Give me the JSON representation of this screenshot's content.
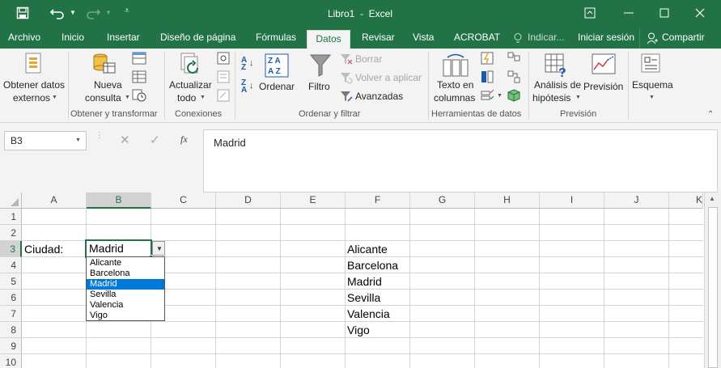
{
  "window": {
    "title": "Libro1  -  Excel"
  },
  "tabs": [
    {
      "label": "Archivo"
    },
    {
      "label": "Inicio"
    },
    {
      "label": "Insertar"
    },
    {
      "label": "Diseño de página"
    },
    {
      "label": "Fórmulas"
    },
    {
      "label": "Datos"
    },
    {
      "label": "Revisar"
    },
    {
      "label": "Vista"
    },
    {
      "label": "ACROBAT"
    },
    {
      "label": "Indicar..."
    }
  ],
  "account": {
    "signin": "Iniciar sesión",
    "share": "Compartir"
  },
  "ribbon": {
    "obtener_datos": {
      "line1": "Obtener datos",
      "line2": "externos"
    },
    "nueva_consulta": {
      "line1": "Nueva",
      "line2": "consulta"
    },
    "group1": "Obtener y transformar",
    "actualizar": {
      "line1": "Actualizar",
      "line2": "todo"
    },
    "group2": "Conexiones",
    "ordenar": "Ordenar",
    "filtro": "Filtro",
    "borrar": "Borrar",
    "volver": "Volver a aplicar",
    "avanzadas": "Avanzadas",
    "group3": "Ordenar y filtrar",
    "texto_columnas": {
      "line1": "Texto en",
      "line2": "columnas"
    },
    "group4": "Herramientas de datos",
    "analisis": {
      "line1": "Análisis de",
      "line2": "hipótesis"
    },
    "prevision": "Previsión",
    "group5": "Previsión",
    "esquema": "Esquema"
  },
  "formula_bar": {
    "name_box": "B3",
    "fx": "fx",
    "value": "Madrid"
  },
  "columns": [
    "A",
    "B",
    "C",
    "D",
    "E",
    "F",
    "G",
    "H",
    "I",
    "J",
    "K"
  ],
  "rows": [
    "1",
    "2",
    "3",
    "4",
    "5",
    "6",
    "7",
    "8",
    "9",
    "10"
  ],
  "cells": {
    "A3": "Ciudad:",
    "B3": "Madrid"
  },
  "list_f": [
    "Alicante",
    "Barcelona",
    "Madrid",
    "Sevilla",
    "Valencia",
    "Vigo"
  ],
  "dropdown": {
    "items": [
      "Alicante",
      "Barcelona",
      "Madrid",
      "Sevilla",
      "Valencia",
      "Vigo"
    ],
    "selected": "Madrid"
  },
  "colors": {
    "brand": "#217346",
    "selection": "#0078d7"
  }
}
